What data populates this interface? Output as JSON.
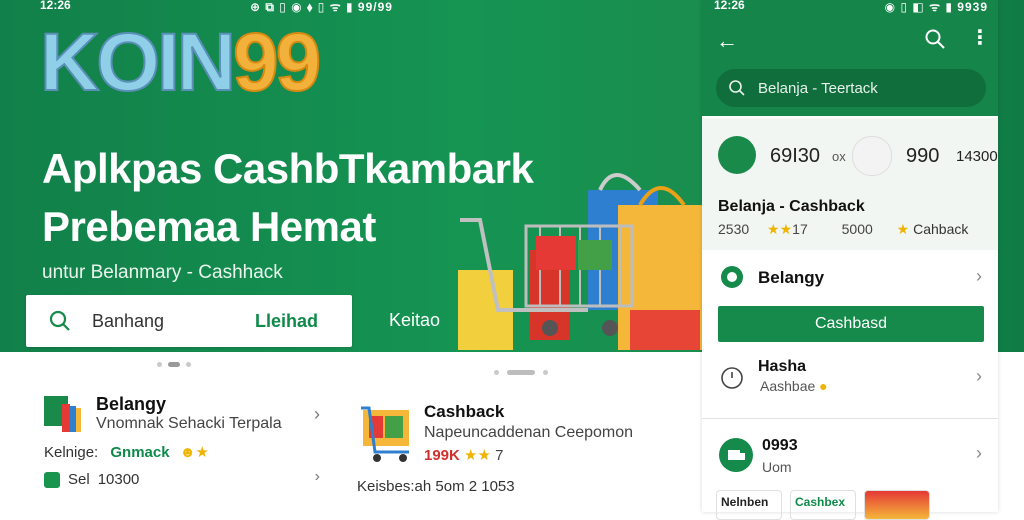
{
  "status": {
    "time": "12:26",
    "icons": "⊕ ⧉ ▯ ◉ ⬧ ▯ ᯤ ▮ 99/99"
  },
  "hero": {
    "logo_part1": "KOIN",
    "logo_part2": "99",
    "headline_line1": "Aplkpas CashbTkambark",
    "headline_line2": "Prebemaa Hemat",
    "subline": "untur Belanmary - Cashhack",
    "search_placeholder": "Banhang",
    "search_action": "Lleihad",
    "side_label": "Keitao"
  },
  "card_left": {
    "title": "Belangy",
    "desc": "Vnomnak Sehacki Terpala",
    "row2_label": "Kelnige:",
    "row2_value": "Gnmack",
    "row3_label": "Sel",
    "row3_value": "10300"
  },
  "card_mid": {
    "title": "Cashback",
    "desc": "Napeuncaddenan Ceepomon",
    "price": "199K",
    "price_stars": "★★",
    "price_tail": "7",
    "footer": "Keisbes:ah  5om 2 1053"
  },
  "phone": {
    "time": "12:26",
    "status_right": "◉ ▯ ◧ ᯤ ▮ 9939",
    "search_placeholder": "Belanja - Teertack",
    "product": {
      "v1": "69I30",
      "x": "ox",
      "v2": "990",
      "v3": "14300",
      "title": "Belanja - Cashback",
      "meta1": "2530",
      "stars": "★★",
      "meta2": "17",
      "meta3": "5000",
      "cashback_star": "★",
      "cashback_label": "Cahback"
    },
    "row_belangy": "Belangy",
    "button_label": "Cashbasd",
    "row_hasha_title": "Hasha",
    "row_hasha_sub": "Aashbae",
    "row_hasha_emoji": "●",
    "row_3_title": "0993",
    "row_3_sub": "Uom",
    "tile1": "Nelnben",
    "tile2": "Cashbex"
  },
  "colors": {
    "brand_green": "#15854a",
    "accent_orange": "#f2b13a",
    "logo_blue": "#8fd0e8"
  }
}
